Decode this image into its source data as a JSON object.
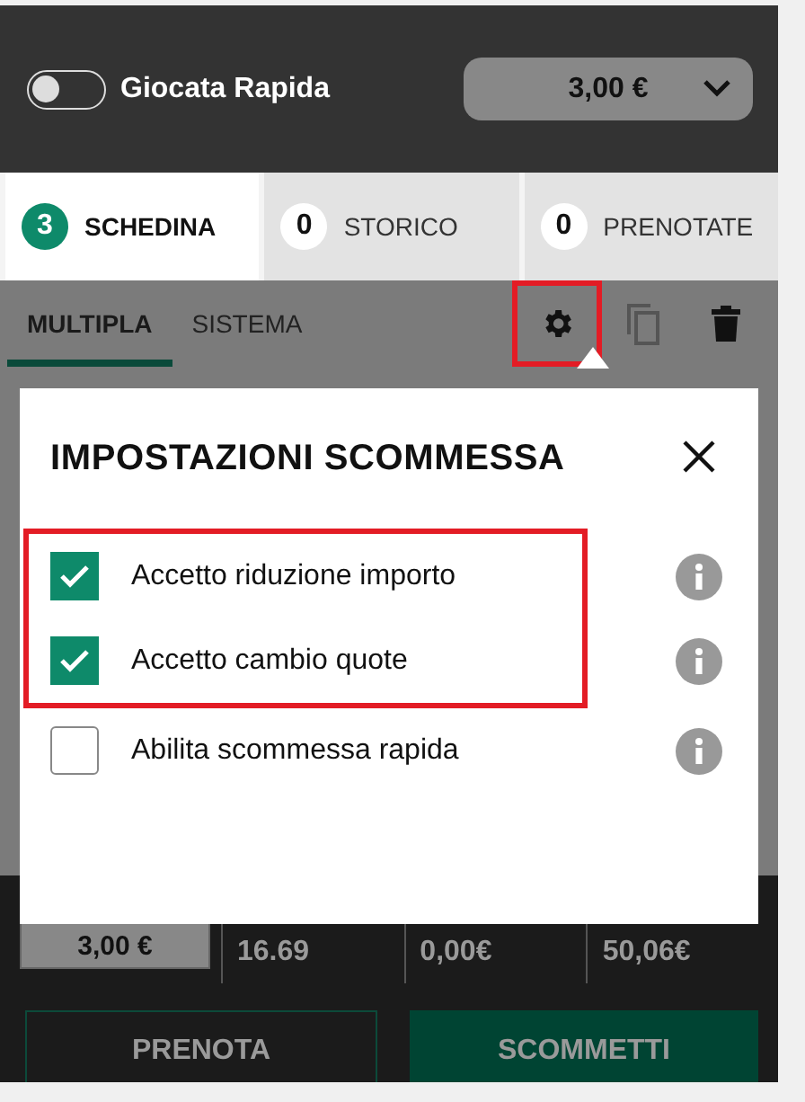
{
  "header": {
    "quick_bet": {
      "label": "Giocata Rapida",
      "on": false
    },
    "stake_select": {
      "value": "3,00 €"
    }
  },
  "tabs": [
    {
      "count": "3",
      "label": "SCHEDINA",
      "selected": true
    },
    {
      "count": "0",
      "label": "STORICO",
      "selected": false
    },
    {
      "count": "0",
      "label": "PRENOTATE",
      "selected": false
    }
  ],
  "bet_types": [
    {
      "label": "MULTIPLA",
      "selected": true
    },
    {
      "label": "SISTEMA",
      "selected": false
    }
  ],
  "actions": [
    {
      "kind": "settings",
      "highlighted": true
    },
    {
      "kind": "copy",
      "highlighted": false
    },
    {
      "kind": "delete",
      "highlighted": false
    }
  ],
  "settings_popup": {
    "title": "IMPOSTAZIONI SCOMMESSA",
    "options": [
      {
        "label": "Accetto riduzione importo",
        "checked": true,
        "highlighted": true
      },
      {
        "label": "Accetto cambio quote",
        "checked": true,
        "highlighted": true
      },
      {
        "label": "Abilita scommessa rapida",
        "checked": false,
        "highlighted": false
      }
    ]
  },
  "summary": {
    "stake": "3,00 €",
    "values": [
      "16.69",
      "0,00€",
      "50,06€"
    ]
  },
  "buttons": [
    {
      "label": "PRENOTA",
      "kind": "outline"
    },
    {
      "label": "SCOMMETTI",
      "kind": "primary"
    }
  ]
}
